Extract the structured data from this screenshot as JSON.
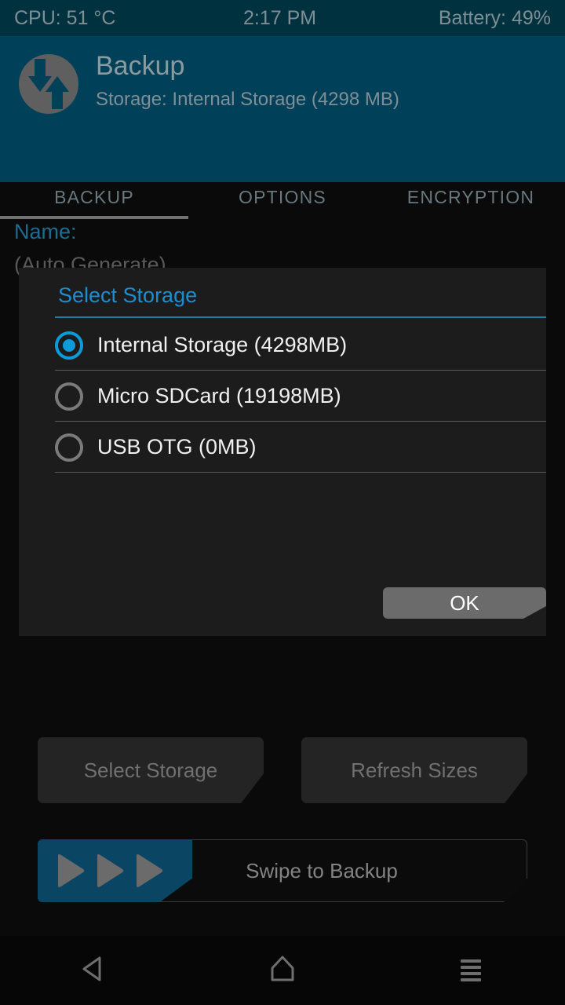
{
  "statusbar": {
    "cpu": "CPU: 51 °C",
    "clock": "2:17 PM",
    "battery": "Battery: 49%"
  },
  "header": {
    "logo_icon": "twrp-logo-icon",
    "title": "Backup",
    "subtitle": "Storage: Internal Storage (4298 MB)",
    "tabs": [
      {
        "label": "BACKUP",
        "active": true
      },
      {
        "label": "OPTIONS",
        "active": false
      },
      {
        "label": "ENCRYPTION",
        "active": false
      }
    ]
  },
  "page": {
    "name_label": "Name:",
    "name_value": "(Auto Generate)"
  },
  "dialog": {
    "title": "Select Storage",
    "options": [
      {
        "label": "Internal Storage (4298MB)",
        "selected": true
      },
      {
        "label": "Micro SDCard (19198MB)",
        "selected": false
      },
      {
        "label": "USB OTG (0MB)",
        "selected": false
      }
    ],
    "ok_label": "OK"
  },
  "actions": {
    "select_storage_label": "Select Storage",
    "refresh_sizes_label": "Refresh Sizes"
  },
  "swipe": {
    "label": "Swipe to Backup",
    "arrow_icon": "play-arrow-icon",
    "arrow_count": 3
  },
  "navbar": {
    "back_icon": "back-triangle-icon",
    "home_icon": "home-icon",
    "menu_icon": "menu-lines-icon"
  },
  "colors": {
    "statusbar_bg": "#00313f",
    "header_bg": "#014059",
    "accent_blue": "#1c8ed0",
    "radio_selected": "#0c9ad8",
    "teal_fill": "#0a4663",
    "dialog_bg": "#1c1c1c",
    "page_bg": "#0a0a0a",
    "ok_button_bg": "#6b6b6b",
    "action_button_bg": "#242424",
    "name_label_color": "#1c6d92"
  }
}
